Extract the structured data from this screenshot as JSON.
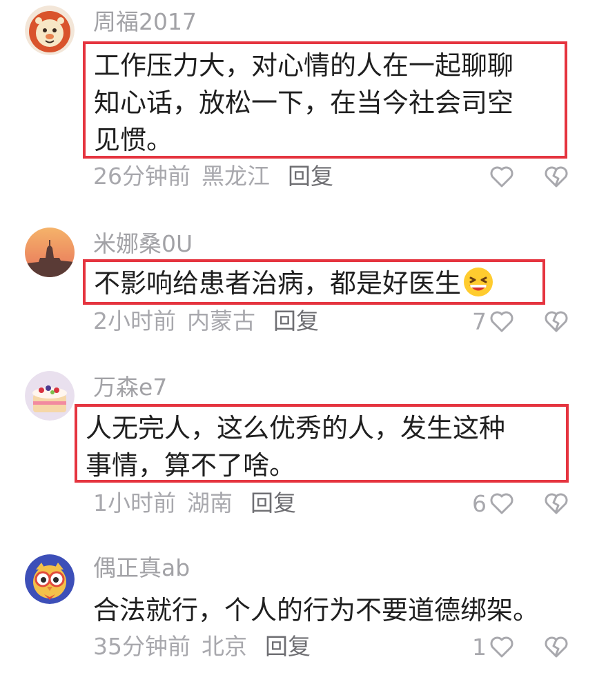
{
  "comments": [
    {
      "username": "周福2017",
      "text": "工作压力大，对心情的人在一起聊聊\n知心话，放松一下，在当今社会司空\n见惯。",
      "time": "26分钟前",
      "region": "黑龙江",
      "reply_label": "回复",
      "likes": "",
      "avatar_icon": "lion-avatar-icon",
      "highlighted": true
    },
    {
      "username": "米娜桑0U",
      "text": "不影响给患者治病，都是好医生",
      "time": "2小时前",
      "region": "内蒙古",
      "reply_label": "回复",
      "likes": "7",
      "avatar_icon": "cathedral-sunset-avatar-icon",
      "emoji": "grinning-squint-emoji-icon",
      "highlighted": true
    },
    {
      "username": "万森e7",
      "text": "人无完人，这么优秀的人，发生这种\n事情，算不了啥。",
      "time": "1小时前",
      "region": "湖南",
      "reply_label": "回复",
      "likes": "6",
      "avatar_icon": "cake-avatar-icon",
      "highlighted": true
    },
    {
      "username": "偶正真ab",
      "text": "合法就行，个人的行为不要道德绑架。",
      "time": "35分钟前",
      "region": "北京",
      "reply_label": "回复",
      "likes": "1",
      "avatar_icon": "owl-avatar-icon",
      "highlighted": false
    }
  ],
  "icons": {
    "like": "heart-outline-icon",
    "dislike": "broken-heart-icon"
  },
  "colors": {
    "highlight_border": "#e5343f",
    "meta_text": "#a8a8ad",
    "comment_text": "#1f1f1f"
  }
}
